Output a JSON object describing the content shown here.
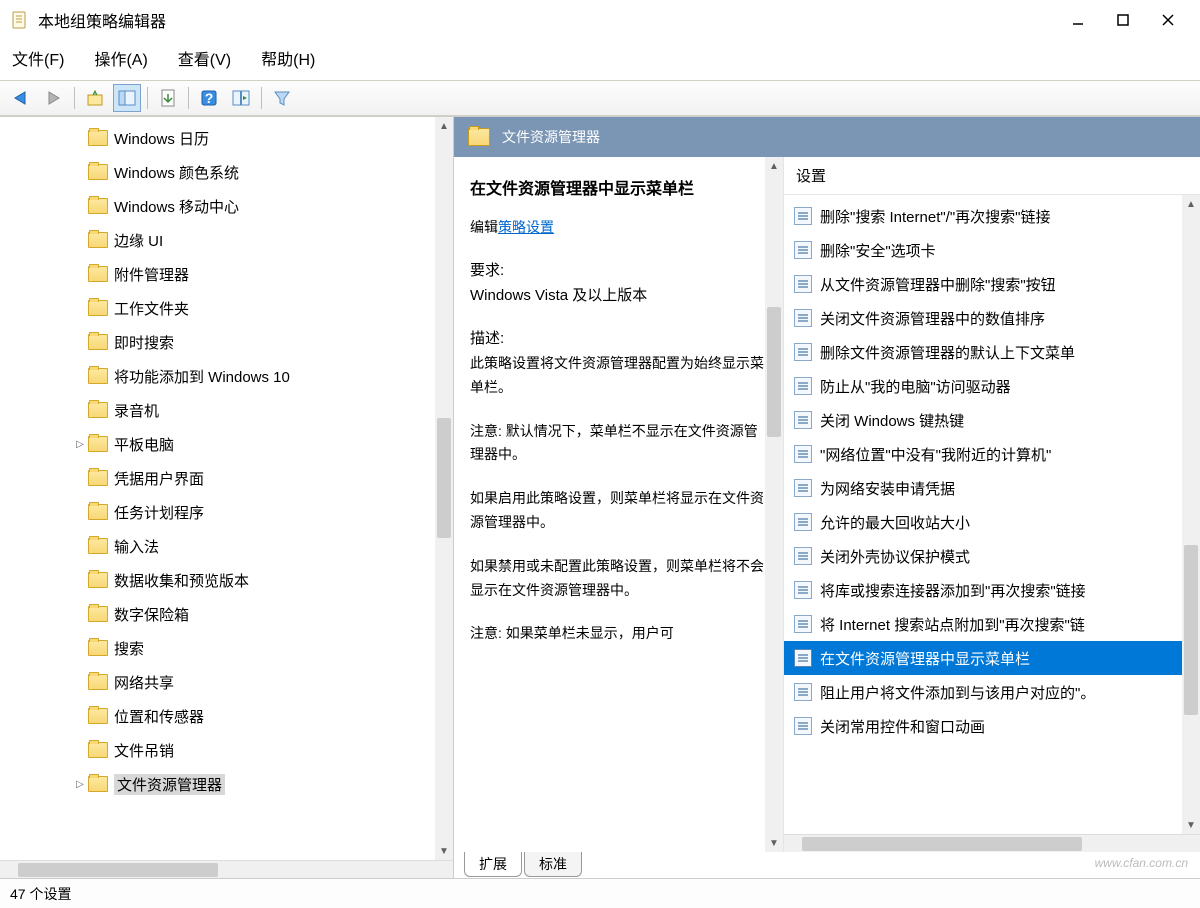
{
  "window": {
    "title": "本地组策略编辑器"
  },
  "menu": {
    "file": "文件(F)",
    "action": "操作(A)",
    "view": "查看(V)",
    "help": "帮助(H)"
  },
  "tree": {
    "items": [
      {
        "label": "Windows 日历",
        "expand": ""
      },
      {
        "label": "Windows 颜色系统",
        "expand": ""
      },
      {
        "label": "Windows 移动中心",
        "expand": ""
      },
      {
        "label": "边缘 UI",
        "expand": ""
      },
      {
        "label": "附件管理器",
        "expand": ""
      },
      {
        "label": "工作文件夹",
        "expand": ""
      },
      {
        "label": "即时搜索",
        "expand": ""
      },
      {
        "label": "将功能添加到 Windows 10",
        "expand": ""
      },
      {
        "label": "录音机",
        "expand": ""
      },
      {
        "label": "平板电脑",
        "expand": "▷"
      },
      {
        "label": "凭据用户界面",
        "expand": ""
      },
      {
        "label": "任务计划程序",
        "expand": ""
      },
      {
        "label": "输入法",
        "expand": ""
      },
      {
        "label": "数据收集和预览版本",
        "expand": ""
      },
      {
        "label": "数字保险箱",
        "expand": ""
      },
      {
        "label": "搜索",
        "expand": ""
      },
      {
        "label": "网络共享",
        "expand": ""
      },
      {
        "label": "位置和传感器",
        "expand": ""
      },
      {
        "label": "文件吊销",
        "expand": ""
      },
      {
        "label": "文件资源管理器",
        "expand": "▷",
        "selected": true
      }
    ]
  },
  "details": {
    "header": "文件资源管理器",
    "selected_title": "在文件资源管理器中显示菜单栏",
    "edit_label": "编辑",
    "edit_link": "策略设置",
    "req_label": "要求:",
    "requirement": "Windows Vista 及以上版本",
    "desc_label": "描述:",
    "desc_p1": "此策略设置将文件资源管理器配置为始终显示菜单栏。",
    "desc_p2": "注意: 默认情况下，菜单栏不显示在文件资源管理器中。",
    "desc_p3": "如果启用此策略设置，则菜单栏将显示在文件资源管理器中。",
    "desc_p4": "如果禁用或未配置此策略设置，则菜单栏将不会显示在文件资源管理器中。",
    "desc_p5": "注意: 如果菜单栏未显示，用户可"
  },
  "settings": {
    "header": "设置",
    "items": [
      "删除\"搜索 Internet\"/\"再次搜索\"链接",
      "删除\"安全\"选项卡",
      "从文件资源管理器中删除\"搜索\"按钮",
      "关闭文件资源管理器中的数值排序",
      "删除文件资源管理器的默认上下文菜单",
      "防止从\"我的电脑\"访问驱动器",
      "关闭 Windows 键热键",
      "\"网络位置\"中没有\"我附近的计算机\"",
      "为网络安装申请凭据",
      "允许的最大回收站大小",
      "关闭外壳协议保护模式",
      "将库或搜索连接器添加到\"再次搜索\"链接",
      "将 Internet 搜索站点附加到\"再次搜索\"链",
      "在文件资源管理器中显示菜单栏",
      "阻止用户将文件添加到与该用户对应的\"。",
      "关闭常用控件和窗口动画"
    ],
    "selected_index": 13
  },
  "tabs": {
    "extended": "扩展",
    "standard": "标准"
  },
  "status": "47 个设置",
  "watermark": "www.cfan.com.cn"
}
